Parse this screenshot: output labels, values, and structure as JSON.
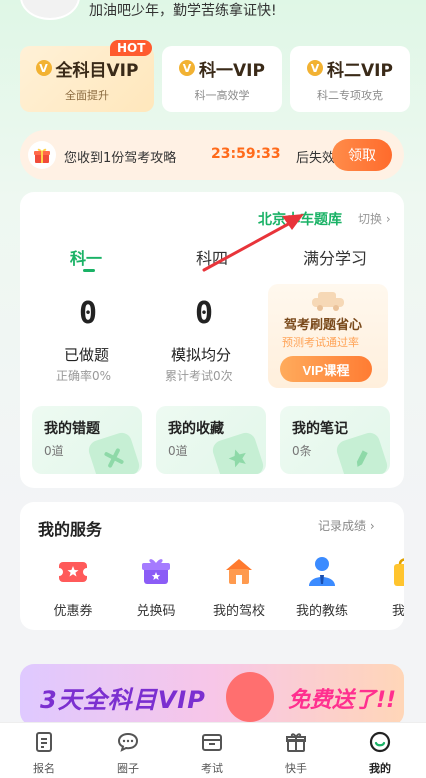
{
  "header": {
    "greeting": "加油吧少年，勤学苦练拿证快!"
  },
  "vip_cards": [
    {
      "title": "全科目VIP",
      "subtitle": "全面提升",
      "badge": "HOT"
    },
    {
      "title": "科一VIP",
      "subtitle": "科一高效学"
    },
    {
      "title": "科二VIP",
      "subtitle": "科二专项攻克"
    }
  ],
  "strategy_banner": {
    "text": "您收到1份驾考攻略",
    "countdown": "23:59:33",
    "countdown_suffix": "后失效",
    "button": "领取"
  },
  "subject_card": {
    "bank_name": "北京小车题库",
    "switch_label": "切换 ›",
    "tabs": [
      "科一",
      "科四",
      "满分学习"
    ],
    "active_tab": "科一",
    "stats": [
      {
        "value": "0",
        "label": "已做题",
        "sub": "正确率0%"
      },
      {
        "value": "0",
        "label": "模拟均分",
        "sub": "累计考试0次"
      }
    ],
    "promo": {
      "title": "驾考刷题省心",
      "subtitle": "预测考试通过率",
      "button": "VIP课程"
    },
    "mini_cards": [
      {
        "title": "我的错题",
        "sub": "0道"
      },
      {
        "title": "我的收藏",
        "sub": "0道"
      },
      {
        "title": "我的笔记",
        "sub": "0条"
      }
    ]
  },
  "services": {
    "title": "我的服务",
    "link": "记录成绩 ›",
    "items": [
      {
        "label": "优惠券",
        "icon": "coupon-icon"
      },
      {
        "label": "兑换码",
        "icon": "gift-box-icon"
      },
      {
        "label": "我的驾校",
        "icon": "school-icon"
      },
      {
        "label": "我的教练",
        "icon": "coach-icon"
      },
      {
        "label": "我的",
        "icon": "bag-icon"
      }
    ]
  },
  "ad_banner": {
    "left_text": "3天全科目VIP",
    "right_text": "免费送了!!"
  },
  "bottom_nav": [
    {
      "label": "报名",
      "icon": "register-icon"
    },
    {
      "label": "圈子",
      "icon": "chat-icon"
    },
    {
      "label": "考试",
      "icon": "exam-icon"
    },
    {
      "label": "快手",
      "icon": "gift-icon"
    },
    {
      "label": "我的",
      "icon": "profile-icon"
    }
  ],
  "active_nav": "我的",
  "colors": {
    "accent_green": "#1ab266",
    "accent_orange": "#ff6b2c",
    "arrow_red": "#e8343a"
  }
}
